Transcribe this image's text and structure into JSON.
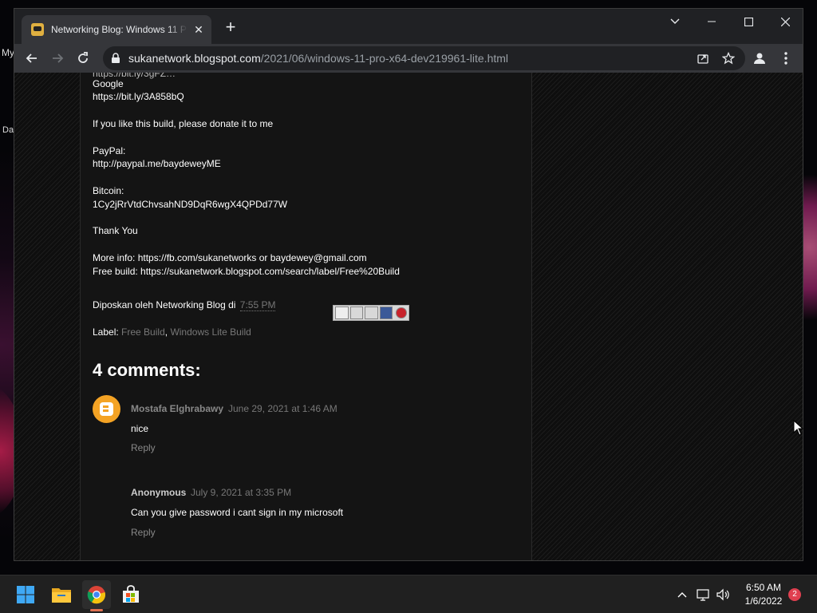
{
  "desktop": {
    "partial_text_1": "My",
    "partial_text_2": "Da"
  },
  "browser": {
    "tab": {
      "title": "Networking Blog: Windows 11 Pr",
      "close": "✕"
    },
    "new_tab": "+",
    "window_controls": [
      "chevron-down",
      "minimize",
      "maximize",
      "close"
    ],
    "address": {
      "host": "sukanetwork.blogspot.com",
      "path": "/2021/06/windows-11-pro-x64-dev219961-lite.html"
    }
  },
  "post": {
    "lines": [
      "Google",
      "https://bit.ly/3A858bQ",
      "If you like this build, please donate it to me",
      "PayPal:",
      "http://paypal.me/baydeweyME",
      "Bitcoin:",
      "1Cy2jRrVtdChvsahND9DqR6wgX4QPDd77W",
      "Thank You",
      "More info: https://fb.com/sukanetworks or baydewey@gmail.com",
      "Free build: https://sukanetwork.blogspot.com/search/label/Free%20Build"
    ],
    "posted_by_prefix": "Diposkan oleh Networking Blog di",
    "posted_time": "7:55 PM",
    "labels_prefix": "Label:",
    "labels": [
      "Free Build",
      "Windows Lite Build"
    ],
    "labels_separator": ","
  },
  "comments": {
    "title": "4 comments:",
    "items": [
      {
        "author": "Mostafa Elghrabawy",
        "date": "June 29, 2021 at 1:46 AM",
        "body": "nice",
        "reply": "Reply"
      },
      {
        "author": "Anonymous",
        "date": "July 9, 2021 at 3:35 PM",
        "body": "Can you give password i cant sign in my microsoft",
        "reply": "Reply"
      }
    ]
  },
  "taskbar": {
    "apps": [
      "windows-start",
      "file-explorer",
      "chrome",
      "microsoft-store"
    ],
    "clock_time": "6:50 AM",
    "clock_date": "1/6/2022",
    "notification_count": "2"
  },
  "colors": {
    "accent_orange": "#f4a324",
    "link_gray": "#777777",
    "page_bg": "#141414"
  }
}
